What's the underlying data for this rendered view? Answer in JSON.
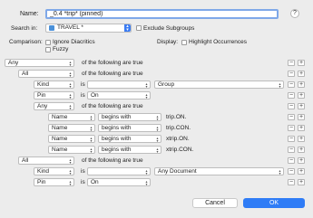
{
  "header": {
    "name_label": "Name:",
    "name_value": "_0.4 *trip* (pinned)",
    "help_label": "?",
    "search_in_label": "Search in:",
    "search_in_value": "TRAVEL *",
    "exclude_subgroups_label": "Exclude Subgroups",
    "comparison_label": "Comparison:",
    "ignore_diacritics_label": "Ignore Diacritics",
    "fuzzy_label": "Fuzzy",
    "display_label": "Display:",
    "highlight_occurrences_label": "Highlight Occurrences"
  },
  "rows": [
    {
      "popup1": "Any",
      "text": "of the following are true"
    },
    {
      "popup1": "All",
      "text": "of the following are true"
    },
    {
      "popup1": "Kind",
      "op": "is",
      "value": "Group"
    },
    {
      "popup1": "Pin",
      "op": "is",
      "value": "On"
    },
    {
      "popup1": "Any",
      "text": "of the following are true"
    },
    {
      "popup1": "Name",
      "op": "begins with",
      "value": "trip.ON."
    },
    {
      "popup1": "Name",
      "op": "begins with",
      "value": "trip.CON."
    },
    {
      "popup1": "Name",
      "op": "begins with",
      "value": "xtrip.ON."
    },
    {
      "popup1": "Name",
      "op": "begins with",
      "value": "xtrip.CON."
    },
    {
      "popup1": "All",
      "text": "of the following are true"
    },
    {
      "popup1": "Kind",
      "op": "is",
      "value": "Any Document"
    },
    {
      "popup1": "Pin",
      "op": "is",
      "value": "On"
    }
  ],
  "minus_label": "−",
  "plus_label": "+",
  "footer": {
    "cancel_label": "Cancel",
    "ok_label": "OK"
  }
}
